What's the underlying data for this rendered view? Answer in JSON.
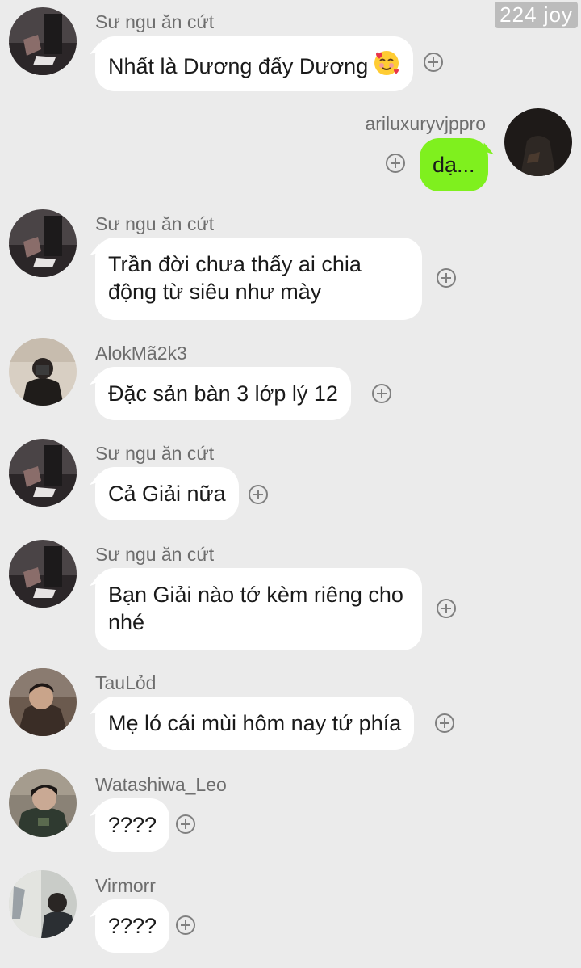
{
  "watermark": "224 joy",
  "messages": [
    {
      "sender": "Sư ngu ăn cứt",
      "text": "Nhất là Dương đấy Dương",
      "emoji": "smiling-face-with-hearts"
    },
    {
      "sender": "ariluxuryvjppro",
      "text": "dạ..."
    },
    {
      "sender": "Sư ngu ăn cứt",
      "lines": [
        "Trần đời chưa thấy ai chia",
        "động từ siêu như mày"
      ]
    },
    {
      "sender": "AlokMã2k3",
      "text": "Đặc sản bàn 3 lớp lý 12"
    },
    {
      "sender": "Sư ngu ăn cứt",
      "text": "Cả Giải nữa"
    },
    {
      "sender": "Sư ngu ăn cứt",
      "lines": [
        "Bạn Giải nào tớ kèm riêng cho",
        "nhé"
      ]
    },
    {
      "sender": "TauLỏd",
      "text": "Mẹ ló cái mùi hôm nay tứ phía"
    },
    {
      "sender": "Watashiwa_Leo",
      "text": "????"
    },
    {
      "sender": "Virmorr",
      "text": "????"
    }
  ],
  "colors": {
    "background": "#ebebeb",
    "incoming_bubble": "#ffffff",
    "outgoing_bubble": "#7ff01e",
    "sender_name": "#6d6d6d"
  }
}
